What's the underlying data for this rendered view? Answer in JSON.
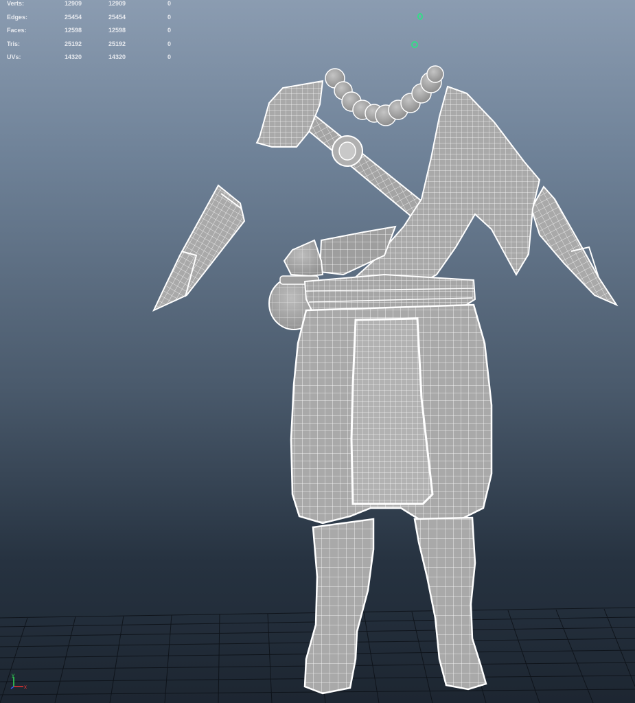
{
  "hud": {
    "rows": [
      {
        "label": "Verts:",
        "c1": "12909",
        "c2": "12909",
        "c3": "0"
      },
      {
        "label": "Edges:",
        "c1": "25454",
        "c2": "25454",
        "c3": "0"
      },
      {
        "label": "Faces:",
        "c1": "12598",
        "c2": "12598",
        "c3": "0"
      },
      {
        "label": "Tris:",
        "c1": "25192",
        "c2": "25192",
        "c3": "0"
      },
      {
        "label": "UVs:",
        "c1": "14320",
        "c2": "14320",
        "c3": "0"
      }
    ]
  },
  "axis": {
    "y_label": "y",
    "x_label": "x"
  },
  "colors": {
    "mesh_fill": "#a9a9a9",
    "wire": "#ffffff",
    "manipulator": "#33dd88",
    "grid_line": "#0c1016"
  }
}
